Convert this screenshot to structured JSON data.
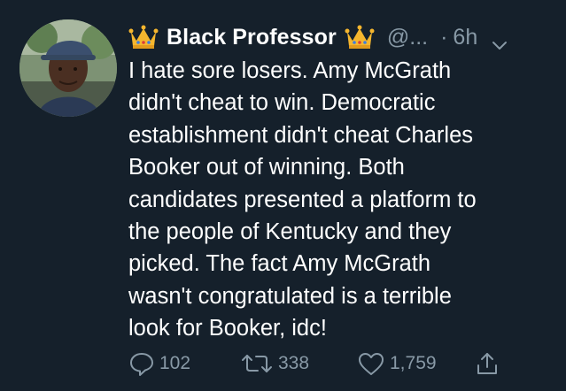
{
  "tweet": {
    "display_name": "Black Professor",
    "handle": "@...",
    "separator": "·",
    "time": "6h",
    "text_lines": [
      "I hate sore losers. Amy McGrath",
      "didn't cheat to win. Democratic",
      "establishment didn't cheat Charles",
      "Booker out of winning. Both",
      "candidates presented a platform to",
      "the people of Kentucky and they",
      "picked. The fact Amy McGrath",
      "wasn't congratulated is a terrible",
      "look for Booker, idc!"
    ],
    "reply_count": "102",
    "retweet_count": "338",
    "like_count": "1,759"
  },
  "icons": {
    "name_prefix": "crown-icon",
    "name_suffix": "crown-icon",
    "menu": "chevron-down-icon",
    "reply": "reply-icon",
    "retweet": "retweet-icon",
    "like": "heart-icon",
    "share": "share-icon"
  },
  "colors": {
    "background": "#15202b",
    "primary_text": "#ffffff",
    "secondary_text": "#8899a6",
    "crown": "#f5b62e"
  }
}
